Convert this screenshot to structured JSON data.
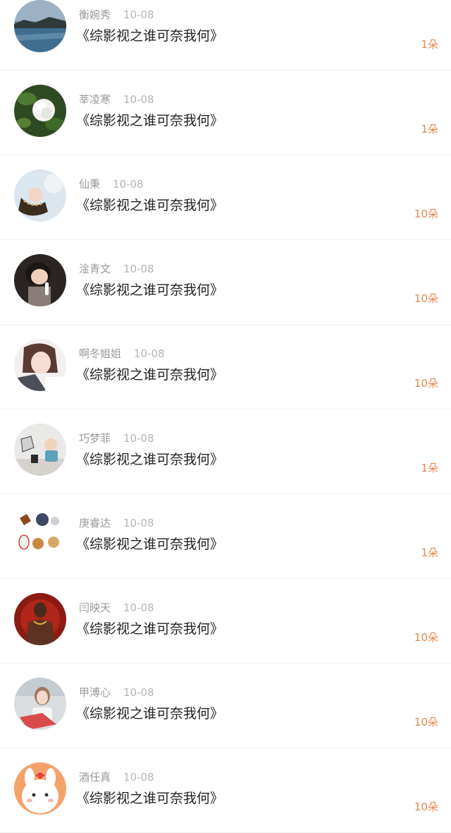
{
  "items": [
    {
      "name": "衡婉秀",
      "date": "10-08",
      "title": "《综影视之谁可奈我何》",
      "count": "1朵",
      "avatar": "lake-landscape-avatar"
    },
    {
      "name": "莘凌寒",
      "date": "10-08",
      "title": "《综影视之谁可奈我何》",
      "count": "1朵",
      "avatar": "white-flower-avatar"
    },
    {
      "name": "仙秉",
      "date": "10-08",
      "title": "《综影视之谁可奈我何》",
      "count": "10朵",
      "avatar": "person-scarf-avatar"
    },
    {
      "name": "淦青文",
      "date": "10-08",
      "title": "《综影视之谁可奈我何》",
      "count": "10朵",
      "avatar": "child-photo-avatar"
    },
    {
      "name": "啊冬姐姐",
      "date": "10-08",
      "title": "《综影视之谁可奈我何》",
      "count": "10朵",
      "avatar": "woman-selfie-avatar"
    },
    {
      "name": "巧梦菲",
      "date": "10-08",
      "title": "《综影视之谁可奈我何》",
      "count": "1朵",
      "avatar": "toddler-avatar"
    },
    {
      "name": "庚睿达",
      "date": "10-08",
      "title": "《综影视之谁可奈我何》",
      "count": "1朵",
      "avatar": "cartoon-animals-avatar"
    },
    {
      "name": "闫映天",
      "date": "10-08",
      "title": "《综影视之谁可奈我何》",
      "count": "10朵",
      "avatar": "man-red-background-avatar"
    },
    {
      "name": "甲溥心",
      "date": "10-08",
      "title": "《综影视之谁可奈我何》",
      "count": "10朵",
      "avatar": "girl-photo-avatar"
    },
    {
      "name": "酒任真",
      "date": "10-08",
      "title": "《综影视之谁可奈我何》",
      "count": "10朵",
      "avatar": "cartoon-bunny-avatar"
    }
  ]
}
